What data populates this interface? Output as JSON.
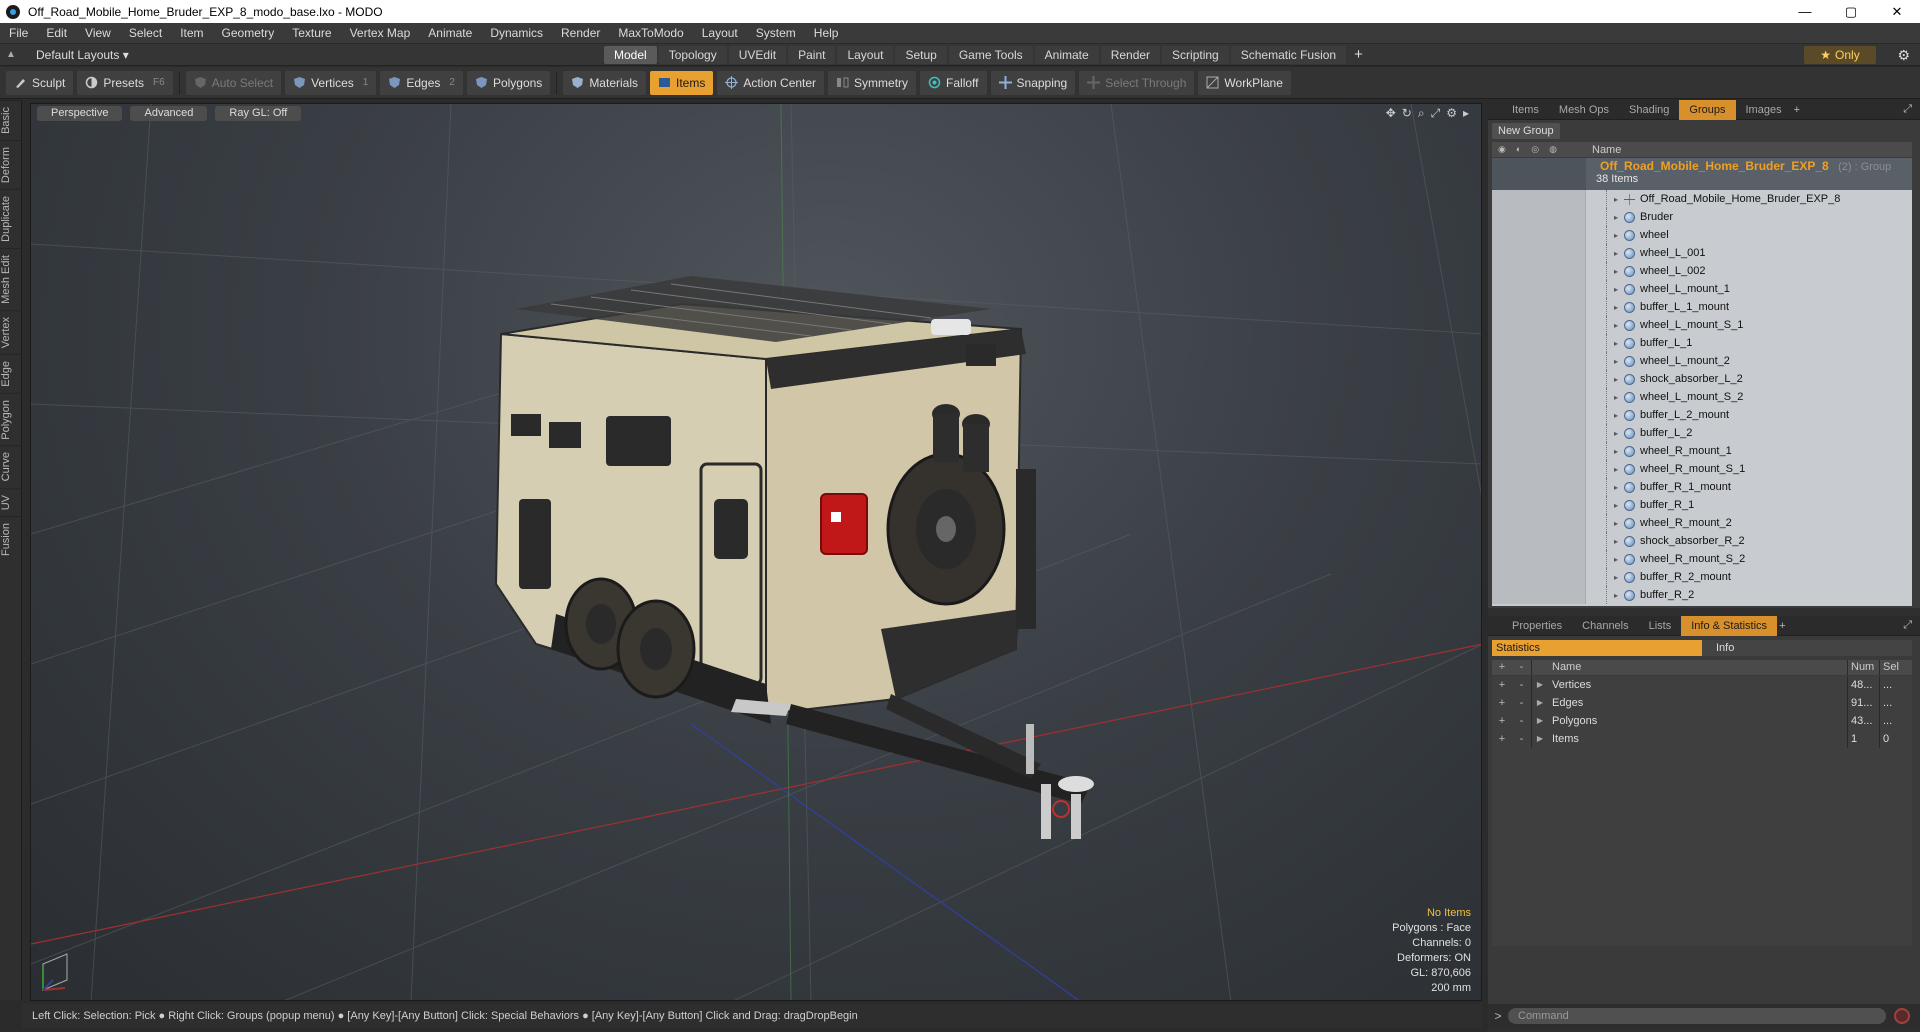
{
  "window": {
    "title": "Off_Road_Mobile_Home_Bruder_EXP_8_modo_base.lxo - MODO",
    "controls": [
      "—",
      "▢",
      "✕"
    ]
  },
  "menu": [
    "File",
    "Edit",
    "View",
    "Select",
    "Item",
    "Geometry",
    "Texture",
    "Vertex Map",
    "Animate",
    "Dynamics",
    "Render",
    "MaxToModo",
    "Layout",
    "System",
    "Help"
  ],
  "layouts": {
    "selector": "Default Layouts ▾",
    "tabs": [
      "Model",
      "Topology",
      "UVEdit",
      "Paint",
      "Layout",
      "Setup",
      "Game Tools",
      "Animate",
      "Render",
      "Scripting",
      "Schematic Fusion"
    ],
    "active_tab": "Model",
    "plus": "+",
    "only_label": "Only"
  },
  "toolbar": {
    "sculpt": "Sculpt",
    "presets": "Presets",
    "presets_key": "F6",
    "auto_select": "Auto Select",
    "vertices": "Vertices",
    "vertices_key": "1",
    "edges": "Edges",
    "edges_key": "2",
    "polygons": "Polygons",
    "materials": "Materials",
    "items": "Items",
    "action_center": "Action Center",
    "symmetry": "Symmetry",
    "falloff": "Falloff",
    "snapping": "Snapping",
    "select_through": "Select Through",
    "workplane": "WorkPlane"
  },
  "left_tabs": [
    "Basic",
    "Deform",
    "Duplicate",
    "Mesh Edit",
    "Vertex",
    "Edge",
    "Polygon",
    "Curve",
    "UV",
    "Fusion"
  ],
  "viewport": {
    "view": "Perspective",
    "shading": "Advanced",
    "raygl": "Ray GL: Off",
    "info": {
      "selection": "No Items",
      "polygons": "Polygons : Face",
      "channels": "Channels: 0",
      "deformers": "Deformers: ON",
      "gl": "GL: 870,606",
      "scale": "200 mm"
    }
  },
  "status": "Left Click: Selection: Pick ● Right Click: Groups (popup menu) ● [Any Key]-[Any Button] Click: Special Behaviors ● [Any Key]-[Any Button] Click and Drag: dragDropBegin",
  "groups_panel": {
    "tabs": [
      "Items",
      "Mesh Ops",
      "Shading",
      "Groups",
      "Images"
    ],
    "active_tab": "Groups",
    "new_group": "New Group",
    "col_name": "Name",
    "group": {
      "name": "Off_Road_Mobile_Home_Bruder_EXP_8",
      "extra": "(2) : Group",
      "count": "38 Items"
    },
    "items": [
      "Off_Road_Mobile_Home_Bruder_EXP_8",
      "Bruder",
      "wheel",
      "wheel_L_001",
      "wheel_L_002",
      "wheel_L_mount_1",
      "buffer_L_1_mount",
      "wheel_L_mount_S_1",
      "buffer_L_1",
      "wheel_L_mount_2",
      "shock_absorber_L_2",
      "wheel_L_mount_S_2",
      "buffer_L_2_mount",
      "buffer_L_2",
      "wheel_R_mount_1",
      "wheel_R_mount_S_1",
      "buffer_R_1_mount",
      "buffer_R_1",
      "wheel_R_mount_2",
      "shock_absorber_R_2",
      "wheel_R_mount_S_2",
      "buffer_R_2_mount",
      "buffer_R_2"
    ]
  },
  "stats_panel": {
    "tabs": [
      "Properties",
      "Channels",
      "Lists",
      "Info & Statistics"
    ],
    "active_tab": "Info & Statistics",
    "subtabs": [
      "Statistics",
      "Info"
    ],
    "columns": [
      "Name",
      "Num",
      "Sel"
    ],
    "rows": [
      {
        "name": "Vertices",
        "num": "48...",
        "sel": "..."
      },
      {
        "name": "Edges",
        "num": "91...",
        "sel": "..."
      },
      {
        "name": "Polygons",
        "num": "43...",
        "sel": "..."
      },
      {
        "name": "Items",
        "num": "1",
        "sel": "0"
      }
    ]
  },
  "command": {
    "placeholder": "Command",
    "prompt": ">"
  },
  "colors": {
    "accent": "#e8a030",
    "group_text": "#f0a020",
    "info_warn": "#f0c040"
  }
}
